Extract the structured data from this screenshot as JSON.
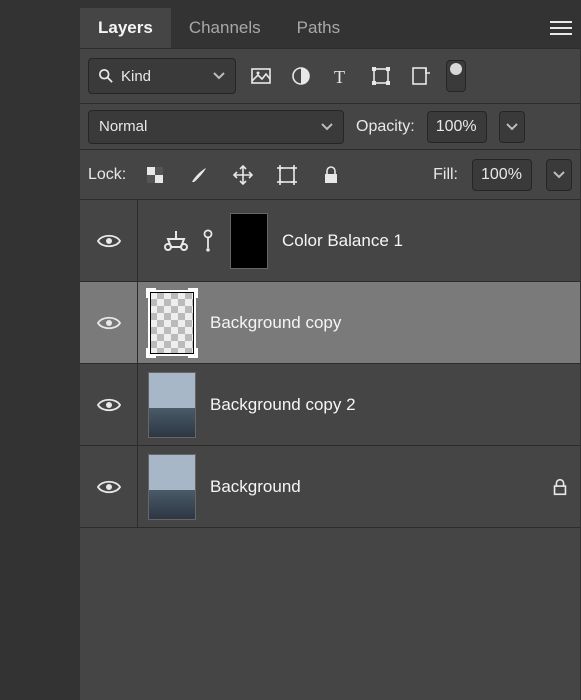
{
  "tabs": {
    "layers": "Layers",
    "channels": "Channels",
    "paths": "Paths"
  },
  "filter": {
    "kind_label": "Kind"
  },
  "blend": {
    "mode": "Normal",
    "opacity_label": "Opacity:",
    "opacity_value": "100%"
  },
  "lock": {
    "label": "Lock:",
    "fill_label": "Fill:",
    "fill_value": "100%"
  },
  "layers": [
    {
      "name": "Color Balance 1"
    },
    {
      "name": "Background copy"
    },
    {
      "name": "Background copy 2"
    },
    {
      "name": "Background"
    }
  ]
}
